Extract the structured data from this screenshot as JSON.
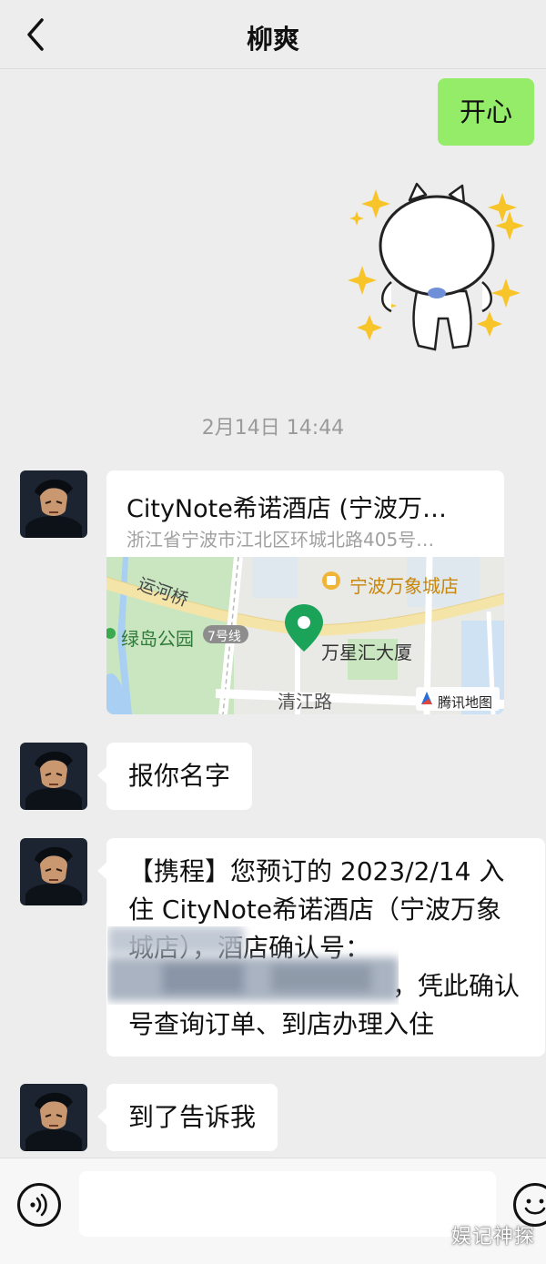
{
  "header": {
    "title": "柳爽",
    "back_icon": "chevron-left-icon"
  },
  "messages": {
    "sent_text": "开心",
    "timestamp": "2月14日 14:44",
    "location": {
      "title": "CityNote希诺酒店 (宁波万…",
      "address": "浙江省宁波市江北区环城北路405号…",
      "map_labels": {
        "bridge": "运河桥",
        "mall": "宁波万象城店",
        "park": "绿岛公园",
        "metro": "7号线",
        "building": "万星汇大厦",
        "road": "清江路",
        "provider": "腾讯地图"
      }
    },
    "text1": "报你名字",
    "booking": {
      "line1": "【携程】您预订的 2023/2/14 入",
      "line2": "住 CityNote希诺酒店（宁波万象",
      "line3": "城店），酒店确认号：",
      "line4": "，凭此确认",
      "line5": "号查询订单、到店办理入住"
    },
    "text2": "到了告诉我"
  },
  "input_bar": {
    "voice_icon": "voice-icon",
    "emoji_icon": "emoji-icon"
  },
  "watermark": "娱记神探",
  "colors": {
    "sent_bubble": "#95ec69",
    "background": "#ededed",
    "map_pin": "#1ca35a"
  }
}
